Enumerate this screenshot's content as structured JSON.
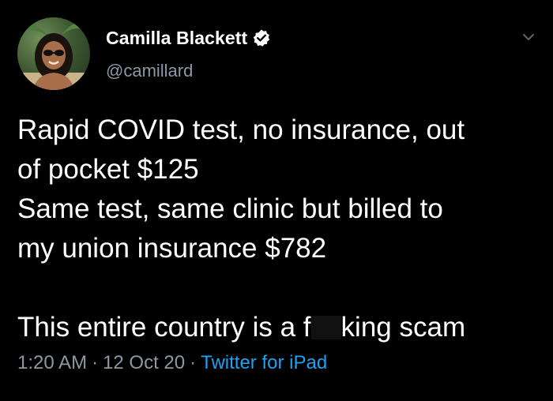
{
  "author": {
    "display_name": "Camilla Blackett",
    "handle": "@camillard",
    "verified": true,
    "avatar_icon": "profile-photo"
  },
  "tweet": {
    "lines": [
      "Rapid COVID test, no insurance, out",
      "of pocket $125",
      "Same test, same clinic but billed to",
      "my union insurance $782"
    ],
    "closing_before": "This entire country is a f",
    "closing_after": "king scam"
  },
  "meta": {
    "time": "1:20 AM",
    "separator": "·",
    "date": "12 Oct 20",
    "source": "Twitter for iPad"
  },
  "colors": {
    "background": "#000000",
    "text": "#ffffff",
    "muted": "#8b98a5",
    "link": "#1da1f2"
  },
  "icons": {
    "verified": "verified-badge-icon",
    "menu": "chevron-down-icon"
  }
}
